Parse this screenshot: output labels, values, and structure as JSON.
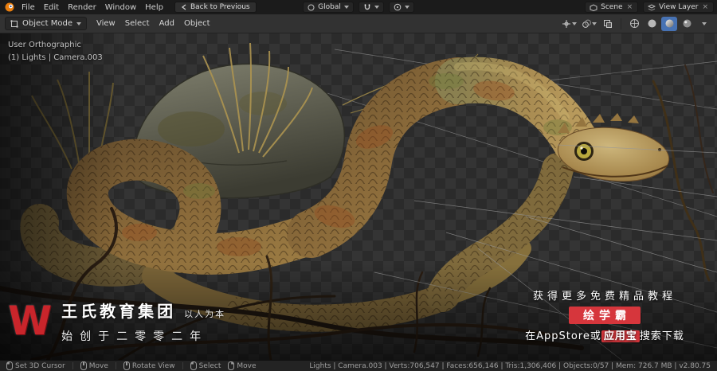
{
  "topbar": {
    "menus": [
      "File",
      "Edit",
      "Render",
      "Window",
      "Help"
    ],
    "back_button": "Back to Previous",
    "transform_orientation": "Global",
    "scene": {
      "label": "Scene"
    },
    "view_layer": {
      "label": "View Layer"
    }
  },
  "viewport_header": {
    "mode": "Object Mode",
    "menus": [
      "View",
      "Select",
      "Add",
      "Object"
    ]
  },
  "viewport": {
    "overlay": {
      "line1": "User Orthographic",
      "line2": "(1) Lights | Camera.003"
    }
  },
  "watermarks": {
    "left": {
      "logo_letter": "W",
      "company": "王氏教育集团",
      "slogan": "以人为本",
      "founded": "始创于二零零二年"
    },
    "right": {
      "line1": "获得更多免费精品教程",
      "badge": "绘学霸",
      "line2_prefix": "在AppStore或",
      "line2_badge": "应用宝",
      "line2_suffix": "搜索下载"
    }
  },
  "statusbar": {
    "hints": [
      "Set 3D Cursor",
      "Move",
      "Rotate View",
      "Select",
      "Move"
    ],
    "stats": "Lights | Camera.003 | Verts:706,547 | Faces:656,146 | Tris:1,306,406 | Objects:0/57 | Mem: 726.7 MB | v2.80.75"
  },
  "colors": {
    "accent": "#4772b3",
    "badge_red": "#d6363c",
    "logo_red": "#c9252b"
  }
}
